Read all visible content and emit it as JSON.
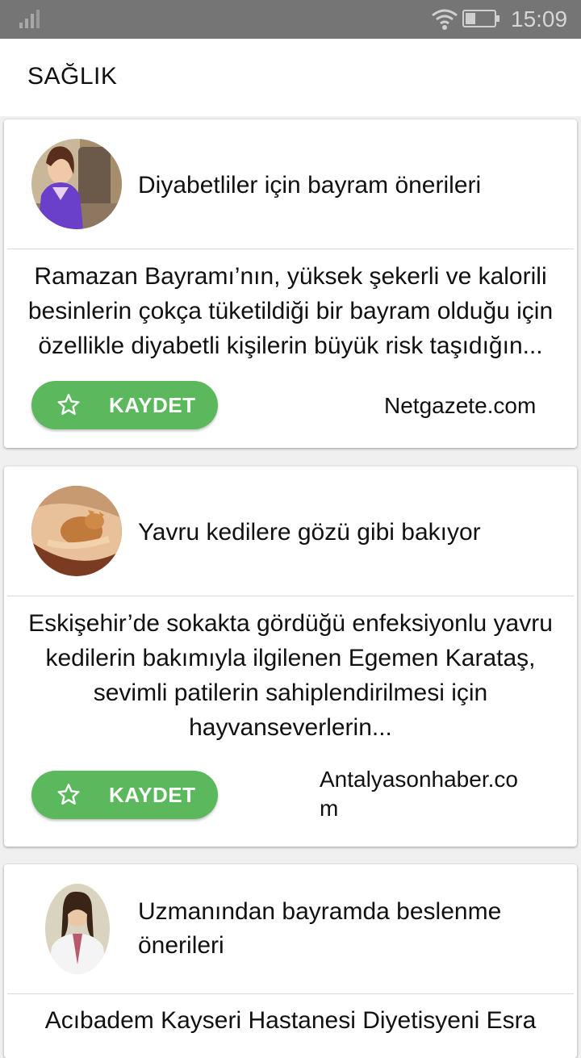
{
  "status_bar": {
    "time": "15:09"
  },
  "app_bar": {
    "title": "SAĞLIK"
  },
  "articles": [
    {
      "headline": "Diyabetliler için bayram önerileri",
      "summary": "Ramazan Bayramı’nın, yüksek şekerli ve kalorili besinlerin çokça tüketildiği bir bayram olduğu için özellikle diyabetli kişilerin büyük risk taşıdığın...",
      "save_label": "KAYDET",
      "source": "Netgazete.com",
      "avatar": "woman-at-desk-photo"
    },
    {
      "headline": "Yavru kedilere gözü gibi bakıyor",
      "summary": "Eskişehir’de sokakta gördüğü enfeksiyonlu yavru kedilerin bakımıyla ilgilenen Egemen Karataş, sevimli patilerin sahiplendirilmesi için hayvanseverlerin...",
      "save_label": "KAYDET",
      "source_line1": "Antalyasonhaber.co",
      "source_line2": "m",
      "avatar": "kitten-in-hands-photo"
    },
    {
      "headline_line1": "Uzmanından bayramda beslenme",
      "headline_line2": "önerileri",
      "summary_partial": "Acıbadem Kayseri Hastanesi Diyetisyeni Esra",
      "avatar": "dietitian-portrait-photo"
    }
  ],
  "icons": {
    "save": "star-outline-icon",
    "signal": "signal-icon",
    "wifi": "wifi-icon",
    "battery": "battery-icon"
  },
  "colors": {
    "accent": "#5cb85c",
    "status_bar": "#757575"
  }
}
